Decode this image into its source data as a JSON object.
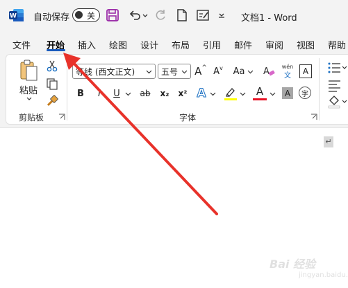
{
  "titlebar": {
    "autosave_label": "自动保存",
    "autosave_state": "关",
    "doc_title": "文档1 - Word"
  },
  "tabs": [
    {
      "label": "文件"
    },
    {
      "label": "开始"
    },
    {
      "label": "插入"
    },
    {
      "label": "绘图"
    },
    {
      "label": "设计"
    },
    {
      "label": "布局"
    },
    {
      "label": "引用"
    },
    {
      "label": "邮件"
    },
    {
      "label": "审阅"
    },
    {
      "label": "视图"
    },
    {
      "label": "帮助"
    }
  ],
  "active_tab": "开始",
  "clipboard": {
    "paste_label": "粘贴",
    "group_label": "剪贴板"
  },
  "font": {
    "font_name": "等线 (西文正文)",
    "font_size": "五号",
    "grow_label": "A",
    "shrink_label": "A",
    "case_label": "Aa",
    "phonetic_top": "wén",
    "phonetic_bottom": "文",
    "border_label": "A",
    "bold_label": "B",
    "italic_label": "I",
    "underline_label": "U",
    "strike_label": "ab",
    "subscript_label": "x₂",
    "superscript_label": "x²",
    "effects_label": "A",
    "font_color_label": "A",
    "shade_label": "A",
    "enclose_label": "字",
    "group_label": "字体"
  },
  "watermark": {
    "brand": "Bai 经验",
    "url": "jingyan.baidu.com"
  },
  "colors": {
    "accent": "#185abd",
    "highlight": "#ffff00",
    "font_color": "#e81123",
    "arrow": "#e8322a",
    "save_icon": "#9b2ca8"
  }
}
